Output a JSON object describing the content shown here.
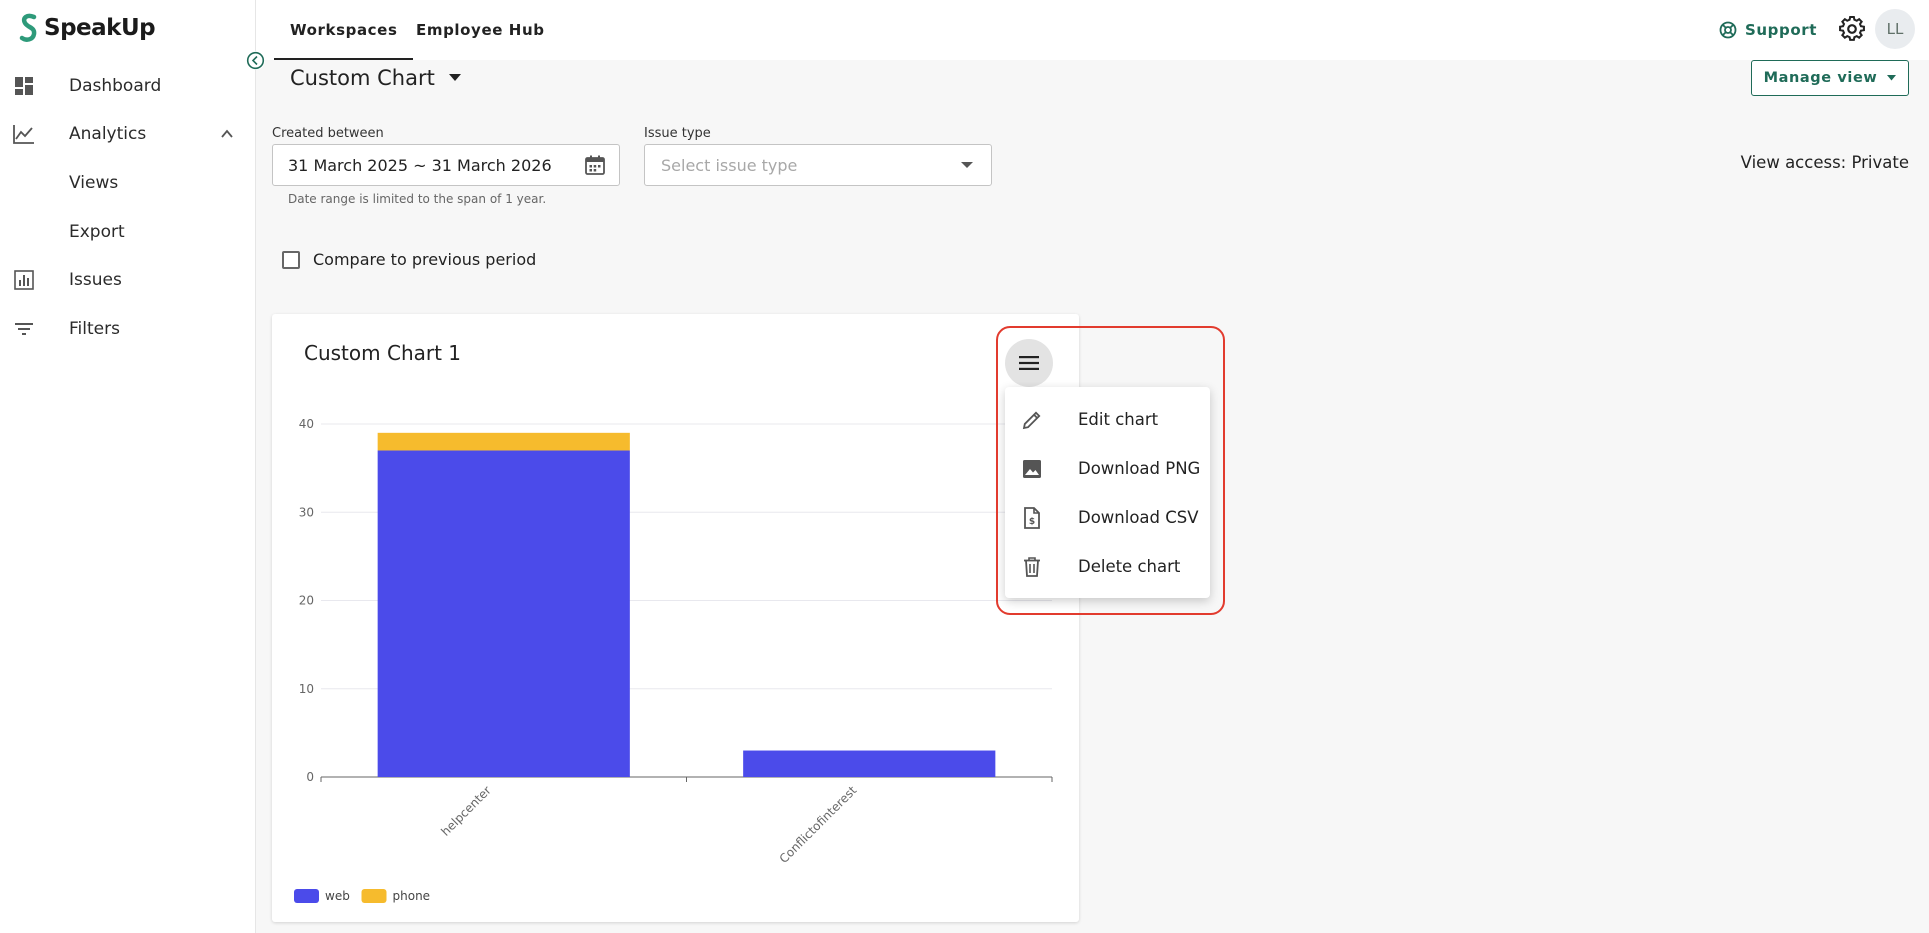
{
  "brand": {
    "name": "SpeakUp",
    "accent": "#1f6b58"
  },
  "sidebar": {
    "items": [
      {
        "label": "Dashboard",
        "icon": "dashboard-icon"
      },
      {
        "label": "Analytics",
        "icon": "analytics-icon",
        "expanded": true
      },
      {
        "label": "Views",
        "icon": ""
      },
      {
        "label": "Export",
        "icon": ""
      },
      {
        "label": "Issues",
        "icon": "issues-icon"
      },
      {
        "label": "Filters",
        "icon": "filter-icon"
      }
    ]
  },
  "topbar": {
    "tabs": [
      {
        "label": "Workspaces",
        "active": true
      },
      {
        "label": "Employee Hub",
        "active": false
      }
    ],
    "support_label": "Support",
    "avatar_initials": "LL"
  },
  "page": {
    "title": "Custom Chart",
    "manage_view_label": "Manage view",
    "view_access": "View access: Private"
  },
  "filters": {
    "created_between_label": "Created between",
    "date_range_value": "31 March 2025 ~ 31 March 2026",
    "date_helper": "Date range is limited to the span of 1 year.",
    "issue_type_label": "Issue type",
    "issue_type_placeholder": "Select issue type",
    "compare_label": "Compare to previous period",
    "compare_checked": false
  },
  "chart_card": {
    "title": "Custom Chart 1"
  },
  "chart_menu": {
    "items": [
      {
        "label": "Edit chart",
        "icon": "pencil-icon"
      },
      {
        "label": "Download PNG",
        "icon": "image-icon"
      },
      {
        "label": "Download CSV",
        "icon": "csv-file-icon"
      },
      {
        "label": "Delete chart",
        "icon": "trash-icon"
      }
    ]
  },
  "chart_data": {
    "type": "bar",
    "stacked": true,
    "categories": [
      "helpcenter",
      "Conflictofinterest"
    ],
    "series": [
      {
        "name": "web",
        "values": [
          37,
          3
        ],
        "color": "#4b4bea"
      },
      {
        "name": "phone",
        "values": [
          2,
          0
        ],
        "color": "#f6bb2d"
      }
    ],
    "yticks": [
      0,
      10,
      20,
      30,
      40
    ],
    "ylim": [
      0,
      40
    ],
    "grid": true,
    "legend": "bottom-left"
  }
}
